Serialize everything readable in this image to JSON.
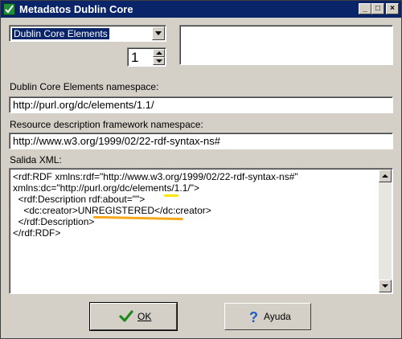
{
  "window": {
    "title": "Metadatos Dublin Core",
    "controls": [
      "_",
      "□",
      "×"
    ]
  },
  "element_select": {
    "value": "Dublin Core Elements"
  },
  "count_spinner": {
    "value": "1"
  },
  "description_box": {
    "value": ""
  },
  "dc_namespace": {
    "label": "Dublin Core Elements namespace:",
    "value": "http://purl.org/dc/elements/1.1/"
  },
  "rdf_namespace": {
    "label": "Resource description framework namespace:",
    "value": "http://www.w3.org/1999/02/22-rdf-syntax-ns#"
  },
  "xml_output": {
    "label": "Salida XML:",
    "lines": [
      "<rdf:RDF xmlns:rdf=\"http://www.w3.org/1999/02/22-rdf-syntax-ns#\"",
      "xmlns:dc=\"http://purl.org/dc/elements/1.1/\">",
      "  <rdf:Description rdf:about=\"\">",
      "    <dc:creator>UNREGISTERED</dc:creator>",
      "  </rdf:Description>",
      "</rdf:RDF>"
    ]
  },
  "buttons": {
    "ok": {
      "label": "OK",
      "icon": "checkmark-icon"
    },
    "help": {
      "label": "Ayuda",
      "icon": "question-icon"
    }
  },
  "colors": {
    "titlebar": "#0a246a",
    "face": "#d4d0c8",
    "highlight_yellow": "#ffe600",
    "highlight_orange": "#f6a81a"
  }
}
